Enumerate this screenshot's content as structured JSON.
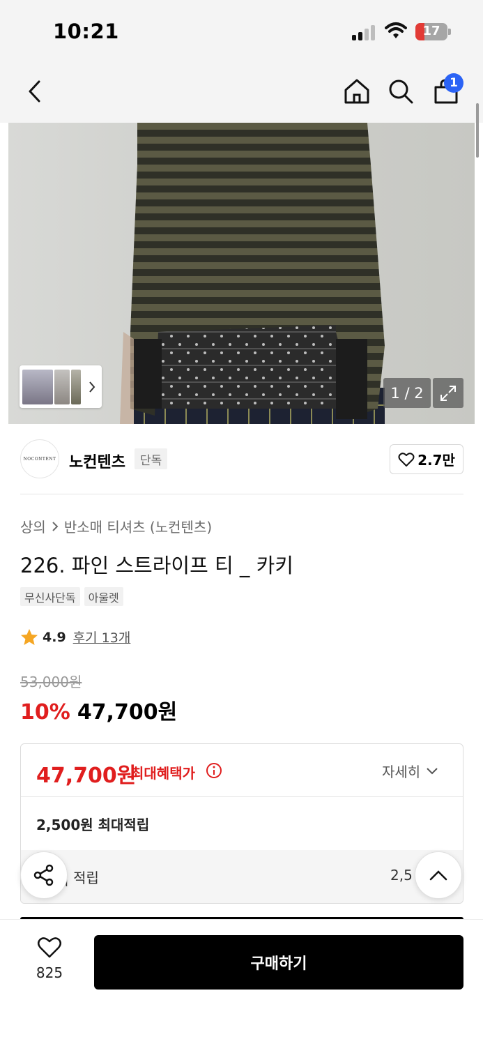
{
  "status_bar": {
    "time": "10:21",
    "battery": "17"
  },
  "nav": {
    "cart_count": "1"
  },
  "gallery": {
    "page_indicator": "1 / 2"
  },
  "brand": {
    "name": "노컨텐츠",
    "badge": "단독",
    "logo_text": "NOCONTENT",
    "likes": "2.7만"
  },
  "product": {
    "breadcrumb": {
      "category": "상의",
      "subcategory": "반소매 티셔츠 (노컨텐츠)"
    },
    "title": "226. 파인 스트라이프 티 _ 카키",
    "tags": [
      "무신사단독",
      "아울렛"
    ],
    "rating": {
      "score": "4.9",
      "review_link": "후기 13개"
    },
    "original_price": "53,000원",
    "discount": "10%",
    "sale_price": "47,700원"
  },
  "benefit": {
    "max_price": "47,700원",
    "max_label": "최대혜택가",
    "detail_label": "자세히",
    "points_total": "2,500원 최대적립",
    "points_sub_label": "| 적립",
    "points_sub_value": "2,5"
  },
  "bottom_bar": {
    "wish_count": "825",
    "buy_label": "구매하기"
  },
  "colors": {
    "accent_red": "#e01e1e",
    "badge_blue": "#2b63f5"
  }
}
